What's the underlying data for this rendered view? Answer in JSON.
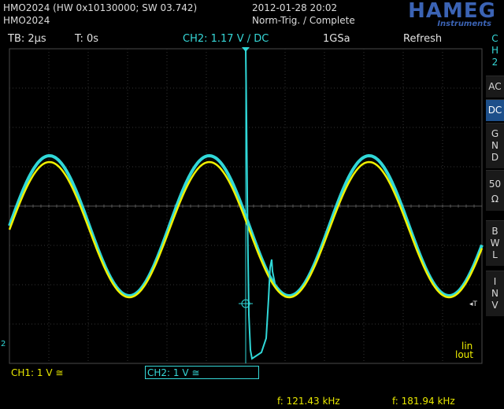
{
  "header": {
    "line1": "HMO2024 (HW 0x10130000; SW 03.742)",
    "line2": "HMO2024",
    "datetime": "2012-01-28 20:02",
    "trig_status": "Norm-Trig. / Complete"
  },
  "logo": {
    "name": "HAMEG",
    "sub": "Instruments"
  },
  "status_bar": {
    "timebase": "TB: 2µs",
    "trigger_time": "T: 0s",
    "trigger": "CH2: 1.17 V ∕ DC",
    "sample_rate": "1GSa",
    "mode": "Refresh"
  },
  "side_menu": {
    "channel": [
      "C",
      "H",
      "2"
    ],
    "buttons": [
      {
        "label": [
          "AC"
        ],
        "selected": false
      },
      {
        "label": [
          "DC"
        ],
        "selected": true
      },
      {
        "label": [
          "G",
          "N",
          "D"
        ],
        "selected": false
      },
      {
        "label": [
          "50",
          "Ω"
        ],
        "selected": false
      },
      {
        "label": [
          "B",
          "W",
          "L"
        ],
        "selected": false
      },
      {
        "label": [
          "I",
          "N",
          "V"
        ],
        "selected": false
      }
    ]
  },
  "markers": {
    "left_marker": "2",
    "right_marker": "◂T",
    "lin_top": "lin",
    "lin_bottom": "lout"
  },
  "channels": {
    "ch1": "CH1: 1 V ≅",
    "ch2": "CH2: 1 V ≅"
  },
  "measurements": {
    "ch1_freq": "f: 121.43 kHz",
    "ch2_freq": "f: 181.94 kHz"
  },
  "colors": {
    "ch1": "#f0f000",
    "ch2": "#30d8d8",
    "grid": "#3c3c3c",
    "accent": "#3b63b4"
  }
}
